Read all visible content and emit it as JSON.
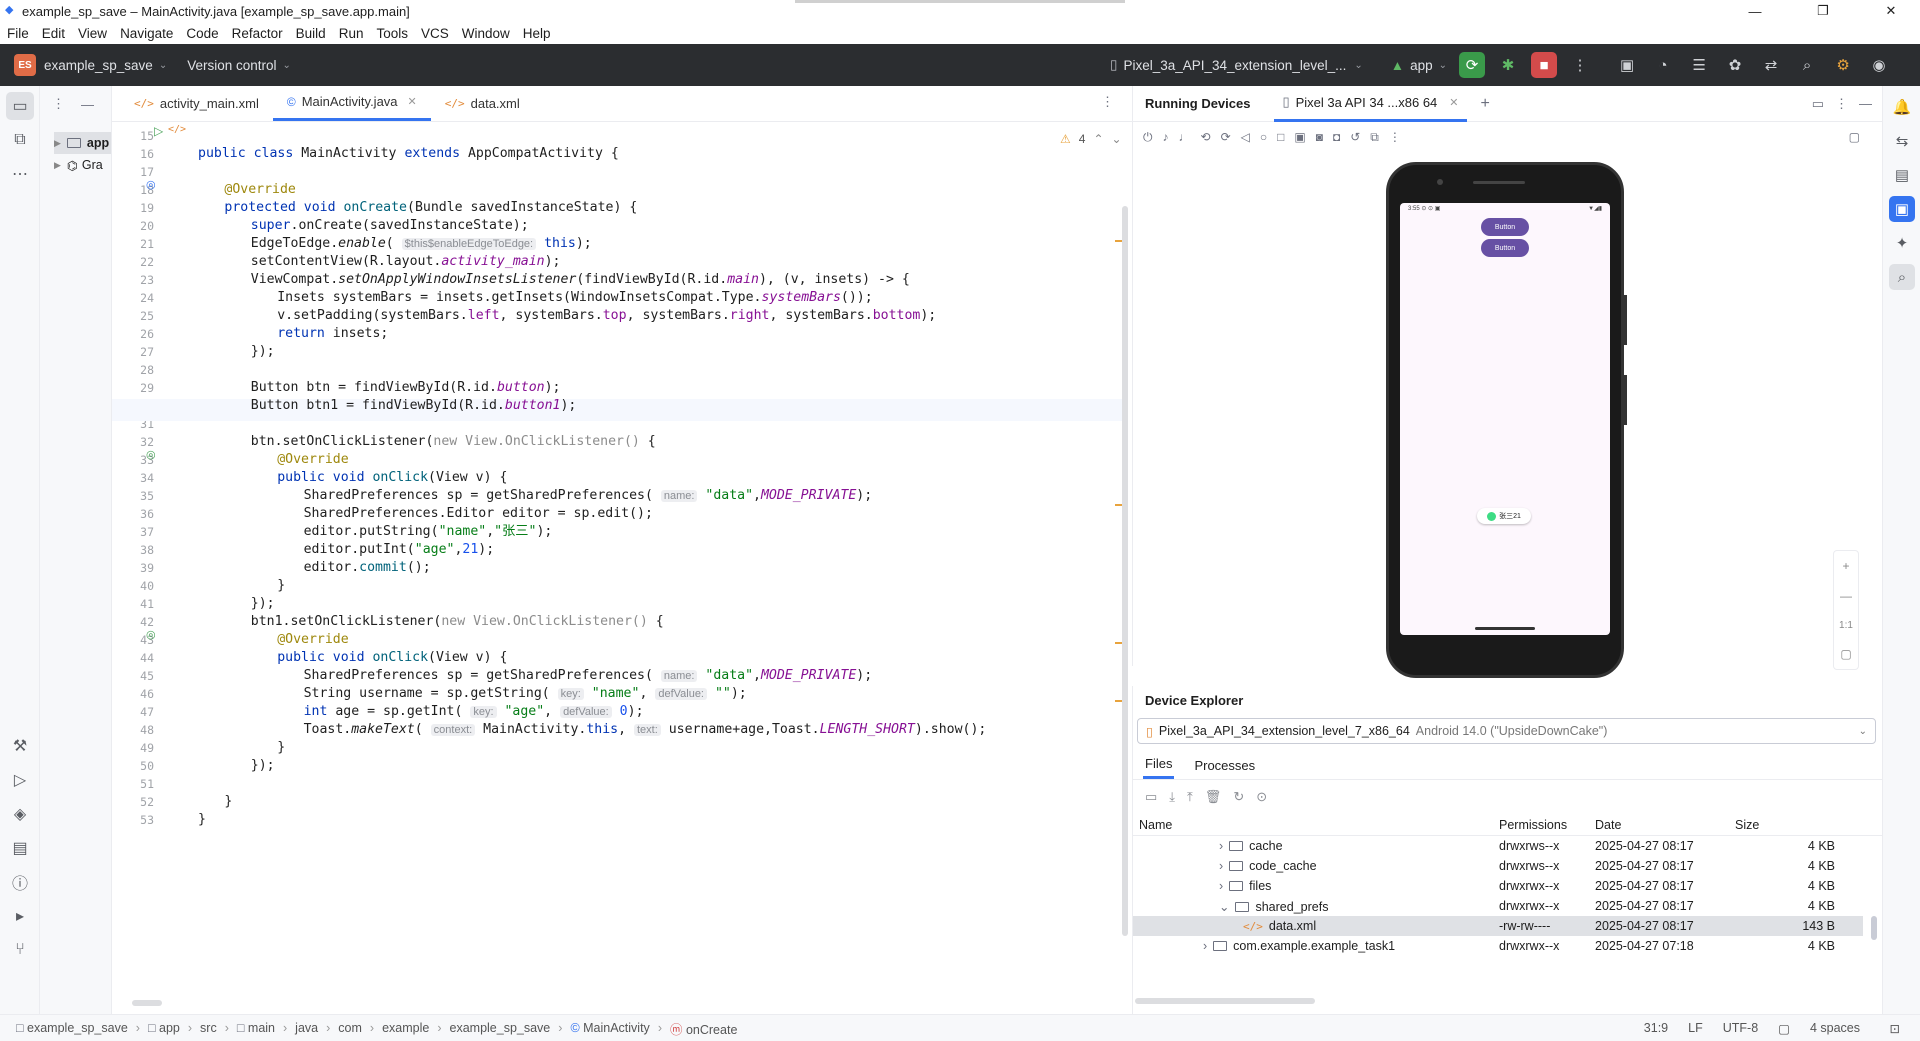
{
  "window": {
    "title": "example_sp_save – MainActivity.java [example_sp_save.app.main]",
    "minimize": "—",
    "maximize": "❐",
    "close": "✕"
  },
  "menu": [
    "File",
    "Edit",
    "View",
    "Navigate",
    "Code",
    "Refactor",
    "Build",
    "Run",
    "Tools",
    "VCS",
    "Window",
    "Help"
  ],
  "toolbar": {
    "project_badge": "ES",
    "project_name": "example_sp_save",
    "vcs": "Version control",
    "device": "Pixel_3a_API_34_extension_level_...",
    "run_config": "app"
  },
  "project_tree": [
    "app",
    "Gra"
  ],
  "editor": {
    "tabs": [
      {
        "label": "activity_main.xml",
        "type": "xml"
      },
      {
        "label": "MainActivity.java",
        "type": "java",
        "active": true
      },
      {
        "label": "data.xml",
        "type": "xml"
      }
    ],
    "warnings": "4",
    "line_numbers": [
      "15",
      "16",
      "17",
      "18",
      "19",
      "20",
      "21",
      "22",
      "23",
      "24",
      "25",
      "26",
      "27",
      "28",
      "29",
      "30",
      "31",
      "32",
      "33",
      "34",
      "35",
      "36",
      "37",
      "38",
      "39",
      "40",
      "41",
      "42",
      "43",
      "44",
      "45",
      "46",
      "47",
      "48",
      "49",
      "50",
      "51",
      "52",
      "53"
    ]
  },
  "code": {
    "l16": [
      "public class ",
      "MainActivity ",
      "extends ",
      "AppCompatActivity {"
    ],
    "l18": "@Override",
    "l19": [
      "protected void ",
      "onCreate",
      "(Bundle savedInstanceState) {"
    ],
    "l20": [
      "super",
      ".onCreate(savedInstanceState);"
    ],
    "l21": [
      "EdgeToEdge.",
      "enable",
      "( ",
      "$this$enableEdgeToEdge:",
      " this",
      ");"
    ],
    "l22": [
      "setContentView(R.layout.",
      "activity_main",
      ");"
    ],
    "l23": [
      "ViewCompat.",
      "setOnApplyWindowInsetsListener",
      "(findViewById(R.id.",
      "main",
      "), (v, insets) -> {"
    ],
    "l24": [
      "Insets systemBars = insets.getInsets(WindowInsetsCompat.Type.",
      "systemBars",
      "());"
    ],
    "l25": [
      "v.setPadding(systemBars.",
      "left",
      ", systemBars.",
      "top",
      ", systemBars.",
      "right",
      ", systemBars.",
      "bottom",
      ");"
    ],
    "l26": [
      "return",
      " insets;"
    ],
    "l27": "});",
    "l29": [
      "Button btn = findViewById(R.id.",
      "button",
      ");"
    ],
    "l30": [
      "Button btn1 = findViewById(R.id.",
      "button1",
      ");"
    ],
    "l32": [
      "btn.setOnClickListener(",
      "new View.OnClickListener()",
      " {"
    ],
    "l33": "@Override",
    "l34": [
      "public void ",
      "onClick",
      "(View v) {"
    ],
    "l35": [
      "SharedPreferences sp = getSharedPreferences( ",
      "name:",
      " \"data\"",
      ",",
      "MODE_PRIVATE",
      ");"
    ],
    "l36": "SharedPreferences.Editor editor = sp.edit();",
    "l37": [
      "editor.putString(",
      "\"name\"",
      ",",
      "\"张三\"",
      ");"
    ],
    "l38": [
      "editor.putInt(",
      "\"age\"",
      ",",
      "21",
      ");"
    ],
    "l39": [
      "editor.",
      "commit",
      "();"
    ],
    "l40": "}",
    "l41": "});",
    "l42": [
      "btn1.setOnClickListener(",
      "new View.OnClickListener()",
      " {"
    ],
    "l43": "@Override",
    "l44": [
      "public void ",
      "onClick",
      "(View v) {"
    ],
    "l45": [
      "SharedPreferences sp = getSharedPreferences( ",
      "name:",
      " \"data\"",
      ",",
      "MODE_PRIVATE",
      ");"
    ],
    "l46": [
      "String username = sp.getString( ",
      "key:",
      " \"name\"",
      ", ",
      "defValue:",
      " \"\"",
      ");"
    ],
    "l47": [
      "int",
      " age = sp.getInt( ",
      "key:",
      " \"age\"",
      ", ",
      "defValue:",
      " 0",
      ");"
    ],
    "l48": [
      "Toast.",
      "makeText",
      "( ",
      "context:",
      " MainActivity.",
      "this",
      ", ",
      "text:",
      " username+age,Toast.",
      "LENGTH_SHORT",
      ").show();"
    ],
    "l49": "}",
    "l50": "});",
    "l52": "}",
    "l53": "}"
  },
  "running_devices": {
    "title": "Running Devices",
    "device_tab": "Pixel 3a API 34 ...x86 64",
    "phone_status": "3:55 ⊙ ⊙ ▣",
    "button1": "Button",
    "button2": "Button",
    "toast": "张三21",
    "zoom_in": "+",
    "zoom_out": "—",
    "zoom_ratio": "1:1"
  },
  "device_explorer": {
    "title": "Device Explorer",
    "device": "Pixel_3a_API_34_extension_level_7_x86_64",
    "device_detail": "Android 14.0 (\"UpsideDownCake\")",
    "tabs": [
      "Files",
      "Processes"
    ],
    "columns": [
      "Name",
      "Permissions",
      "Date",
      "Size"
    ],
    "rows": [
      {
        "name": "cache",
        "perm": "drwxrws--x",
        "date": "2025-04-27 08:17",
        "size": "4 KB"
      },
      {
        "name": "code_cache",
        "perm": "drwxrws--x",
        "date": "2025-04-27 08:17",
        "size": "4 KB"
      },
      {
        "name": "files",
        "perm": "drwxrwx--x",
        "date": "2025-04-27 08:17",
        "size": "4 KB"
      },
      {
        "name": "shared_prefs",
        "perm": "drwxrwx--x",
        "date": "2025-04-27 08:17",
        "size": "4 KB"
      },
      {
        "name": "data.xml",
        "perm": "-rw-rw----",
        "date": "2025-04-27 08:17",
        "size": "143 B"
      },
      {
        "name": "com.example.example_task1",
        "perm": "drwxrwx--x",
        "date": "2025-04-27 07:18",
        "size": "4 KB"
      }
    ]
  },
  "statusbar": {
    "breadcrumbs": [
      "example_sp_save",
      "app",
      "src",
      "main",
      "java",
      "com",
      "example",
      "example_sp_save",
      "MainActivity",
      "onCreate"
    ],
    "position": "31:9",
    "line_sep": "LF",
    "encoding": "UTF-8",
    "indent": "4 spaces"
  }
}
